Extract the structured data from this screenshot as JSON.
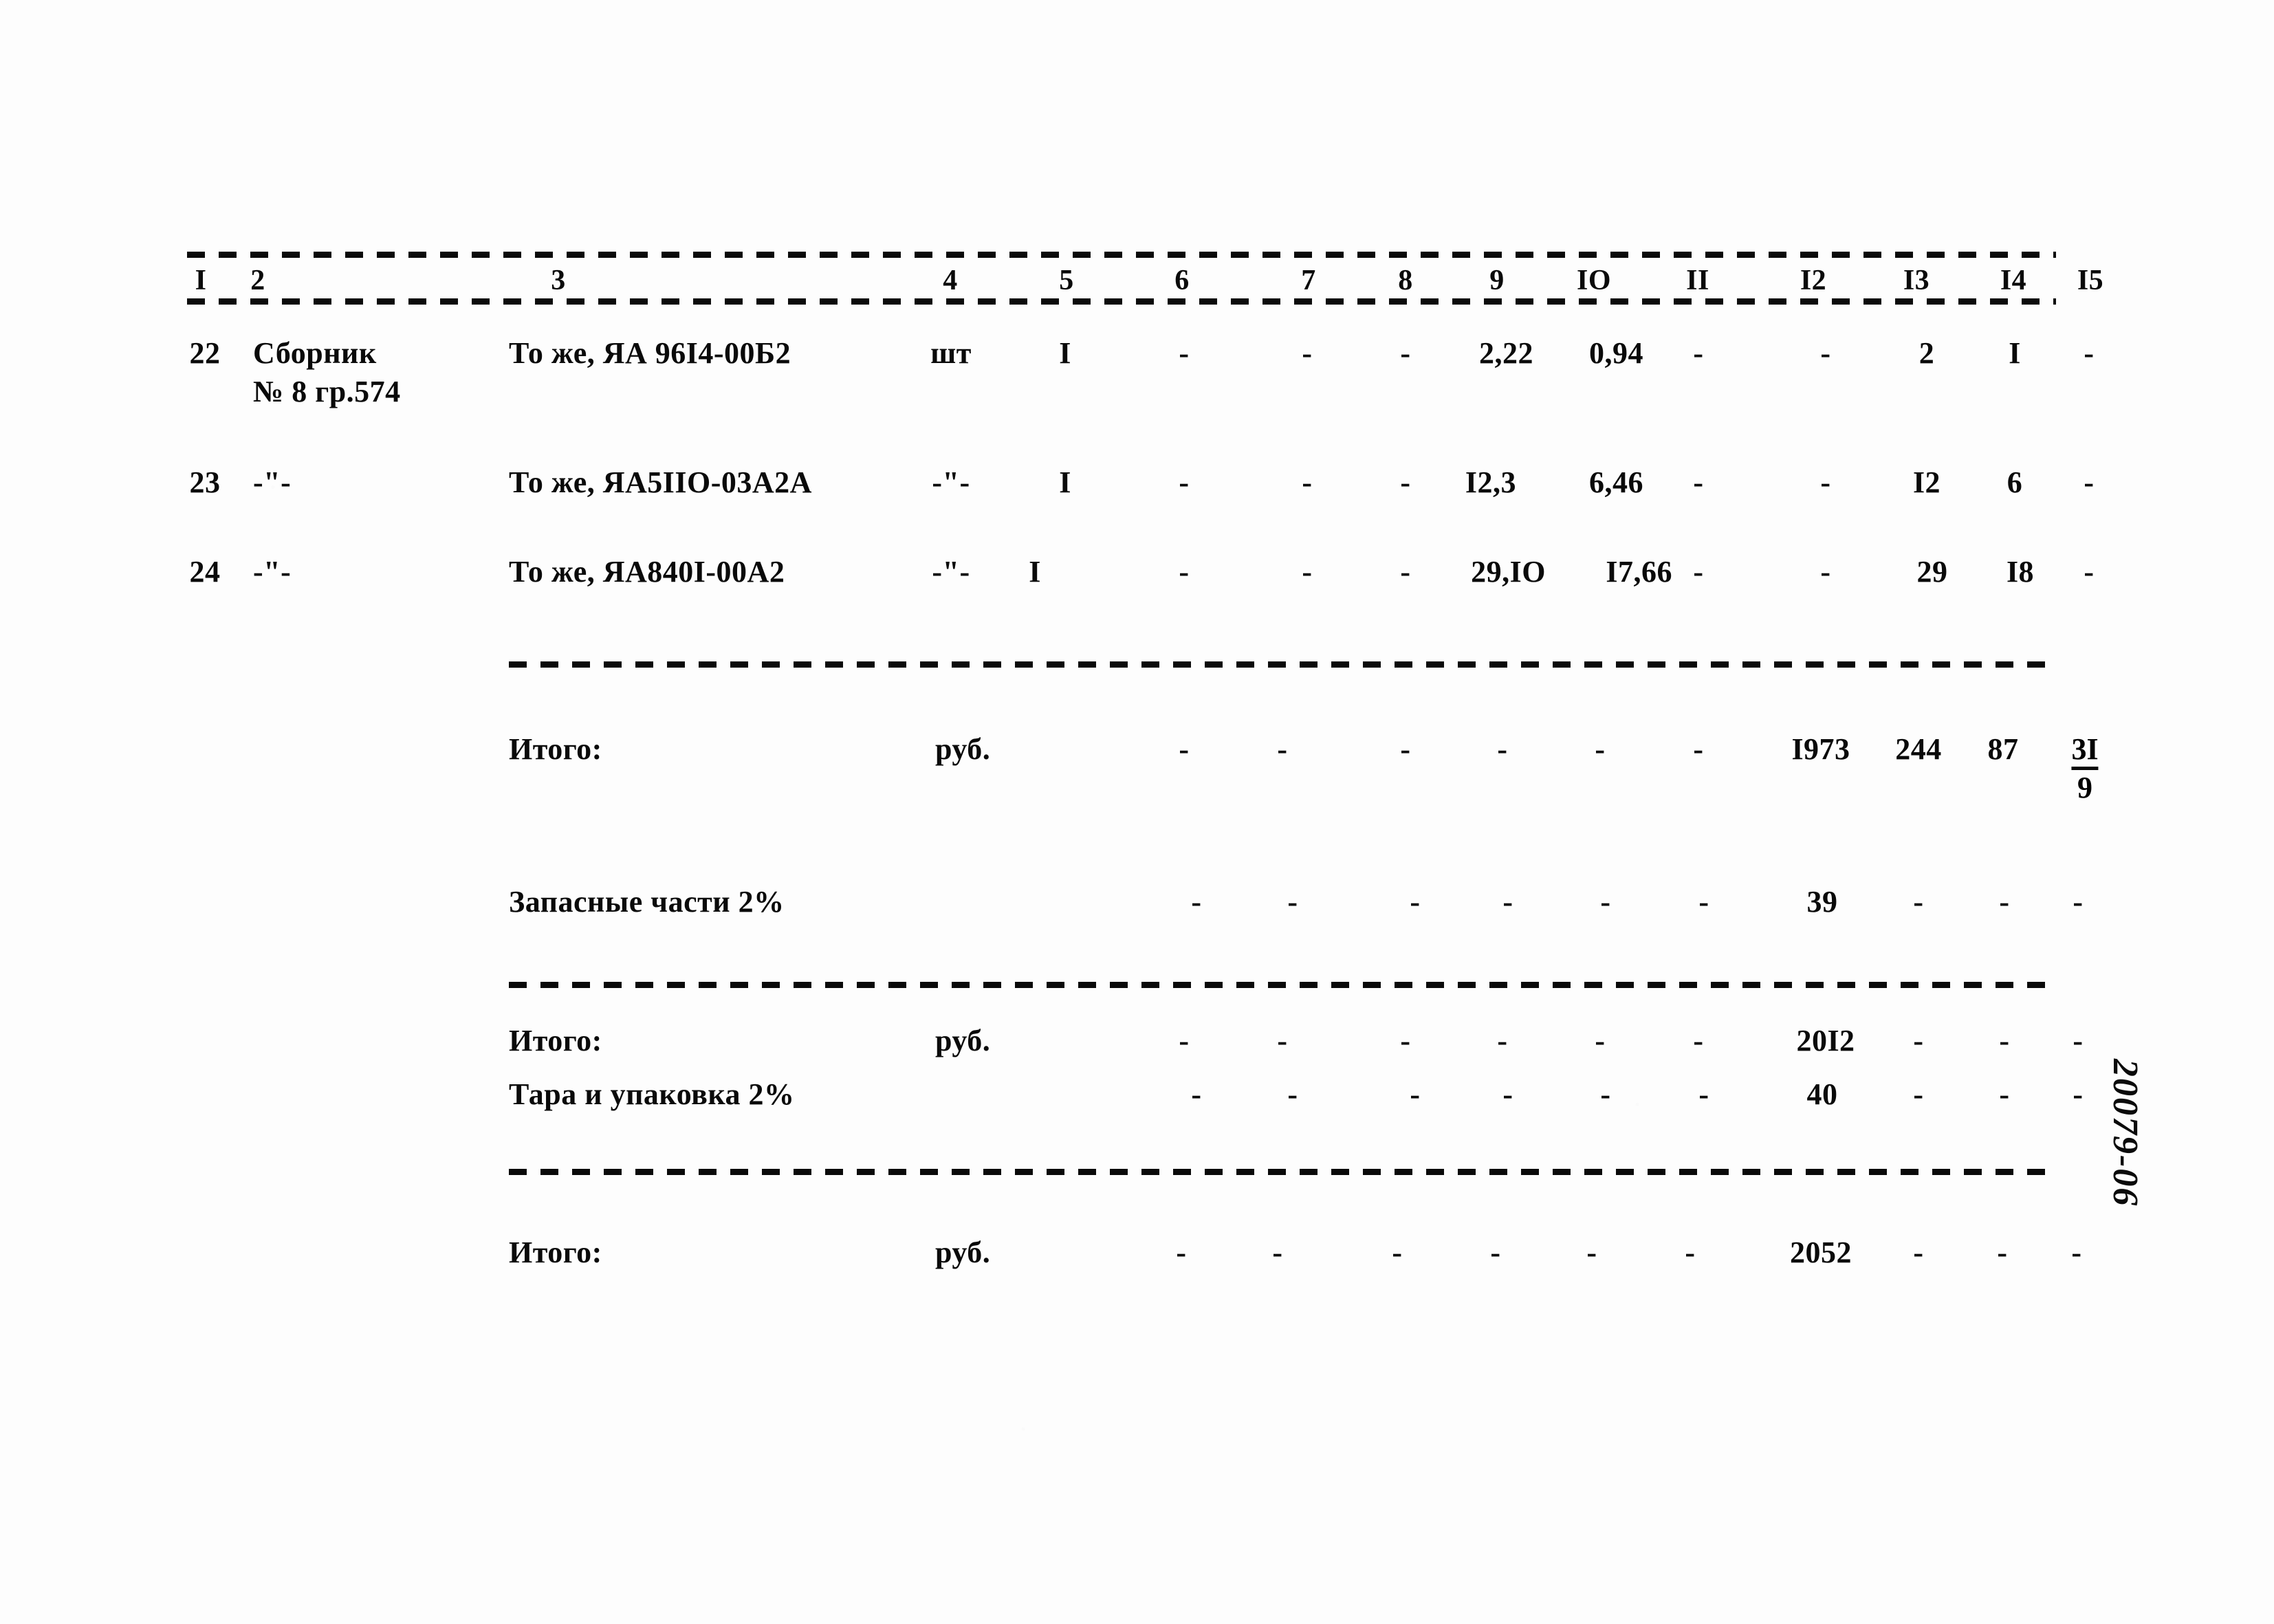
{
  "document": {
    "margin_stamp": "20079-06"
  },
  "table": {
    "column_headers": [
      "I",
      "2",
      "3",
      "4",
      "5",
      "6",
      "7",
      "8",
      "9",
      "IO",
      "II",
      "I2",
      "I3",
      "I4",
      "I5"
    ],
    "rows": [
      {
        "num": "22",
        "source": "Сборник",
        "source_line2": "№ 8 гр.574",
        "description": "То же, ЯА 96I4-00Б2",
        "unit": "шт",
        "qty": "I",
        "c6": "-",
        "c7": "-",
        "c8": "-",
        "c9": "2,22",
        "c10": "0,94",
        "c11": "-",
        "c12": "-",
        "c13": "2",
        "c14": "I",
        "c15": "-"
      },
      {
        "num": "23",
        "source": "-\"-",
        "source_line2": "",
        "description": "То же, ЯА5IIO-03А2А",
        "unit": "-\"-",
        "qty": "I",
        "c6": "-",
        "c7": "-",
        "c8": "-",
        "c9": "I2,3",
        "c10": "6,46",
        "c11": "-",
        "c12": "-",
        "c13": "I2",
        "c14": "6",
        "c15": "-"
      },
      {
        "num": "24",
        "source": "-\"-",
        "source_line2": "",
        "description": "То же, ЯА840I-00А2",
        "unit": "-\"-",
        "qty": "I",
        "c6": "-",
        "c7": "-",
        "c8": "-",
        "c9": "29,IO",
        "c10": "I7,66",
        "c11": "-",
        "c12": "-",
        "c13": "29",
        "c14": "I8",
        "c15": "-"
      }
    ],
    "summary_rows": [
      {
        "label": "Итого:",
        "unit": "руб.",
        "c6": "-",
        "c7": "-",
        "c8": "-",
        "c9": "-",
        "c10": "-",
        "c11": "-",
        "c12": "I973",
        "c13": "244",
        "c14": "87",
        "c15_numerator": "3I",
        "c15_denominator": "9"
      },
      {
        "label": "Запасные части 2%",
        "unit": "",
        "c6": "-",
        "c7": "-",
        "c8": "-",
        "c9": "-",
        "c10": "-",
        "c11": "-",
        "c12": "39",
        "c13": "-",
        "c14": "-",
        "c15": "-"
      },
      {
        "label": "Итого:",
        "unit": "руб.",
        "c6": "-",
        "c7": "-",
        "c8": "-",
        "c9": "-",
        "c10": "-",
        "c11": "-",
        "c12": "20I2",
        "c13": "-",
        "c14": "-",
        "c15": "-"
      },
      {
        "label": "Тара и упаковка 2%",
        "unit": "",
        "c6": "-",
        "c7": "-",
        "c8": "-",
        "c9": "-",
        "c10": "-",
        "c11": "-",
        "c12": "40",
        "c13": "-",
        "c14": "-",
        "c15": "-"
      },
      {
        "label": "Итого:",
        "unit": "руб.",
        "c6": "-",
        "c7": "-",
        "c8": "-",
        "c9": "-",
        "c10": "-",
        "c11": "-",
        "c12": "2052",
        "c13": "-",
        "c14": "-",
        "c15": "-"
      }
    ]
  }
}
